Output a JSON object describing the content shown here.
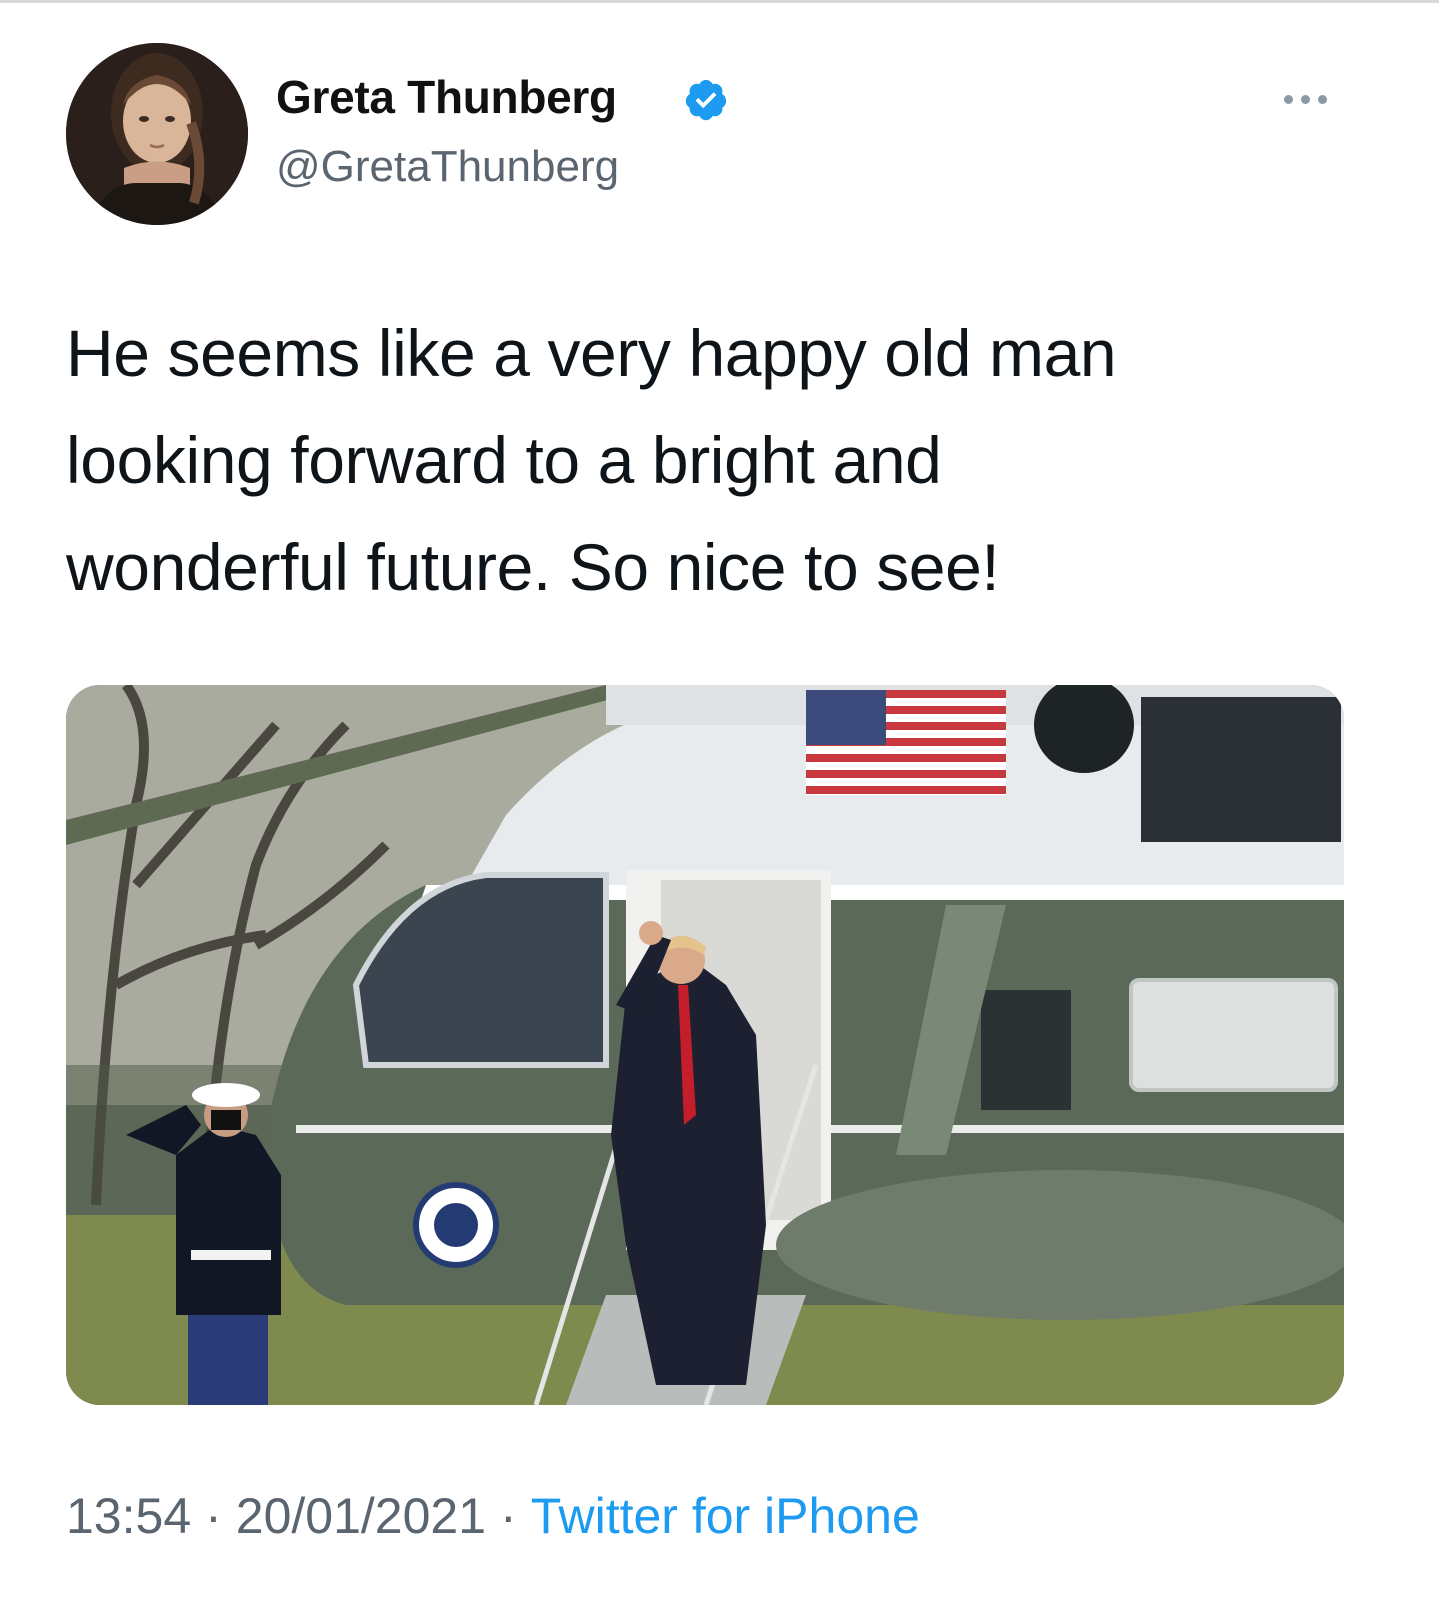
{
  "tweet": {
    "author": {
      "display_name": "Greta Thunberg",
      "handle": "@GretaThunberg",
      "verified": true,
      "avatar_icon": "profile-photo"
    },
    "more_icon": "more-horizontal-icon",
    "text_lines": [
      "He seems like a very happy old man",
      "looking forward to a bright and",
      "wonderful future. So nice to see!"
    ],
    "media": {
      "type": "photo"
    },
    "meta": {
      "time": "13:54",
      "date": "20/01/2021",
      "separator": "·",
      "source": "Twitter for iPhone"
    }
  },
  "colors": {
    "link": "#1d9bf0",
    "secondary_text": "#5b6570",
    "verified_badge": "#1d9bf0"
  }
}
